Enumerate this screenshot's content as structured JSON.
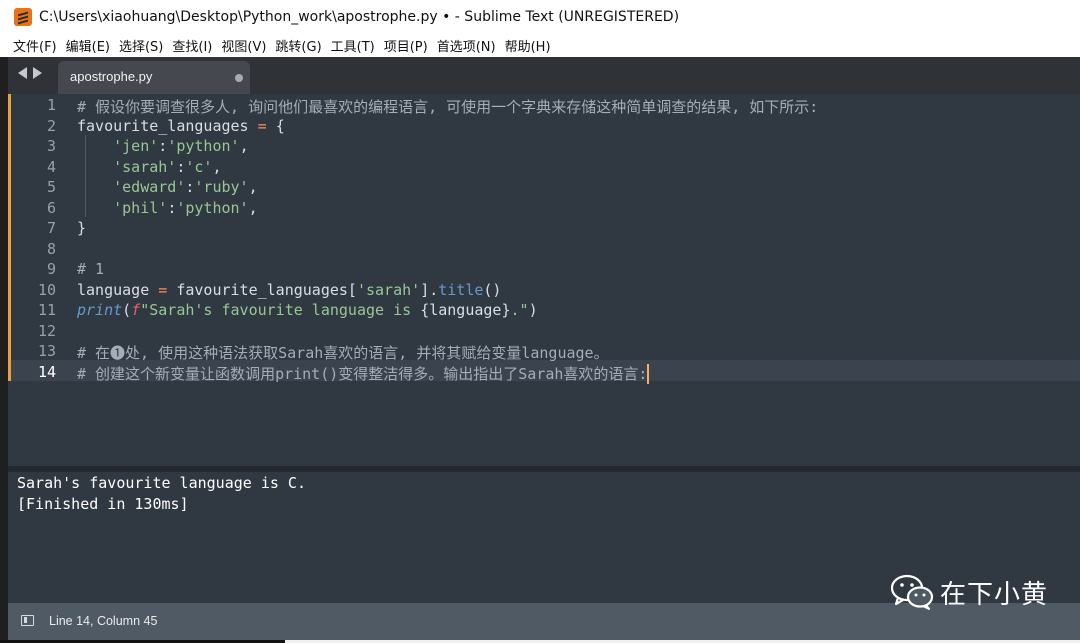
{
  "window": {
    "title": "C:\\Users\\xiaohuang\\Desktop\\Python_work\\apostrophe.py • - Sublime Text (UNREGISTERED)"
  },
  "menu": {
    "items": [
      "文件(F)",
      "编辑(E)",
      "选择(S)",
      "查找(I)",
      "视图(V)",
      "跳转(G)",
      "工具(T)",
      "项目(P)",
      "首选项(N)",
      "帮助(H)"
    ]
  },
  "tabs": [
    {
      "label": "apostrophe.py",
      "modified": true
    }
  ],
  "editor": {
    "current_line": 14,
    "line_numbers": [
      "1",
      "2",
      "3",
      "4",
      "5",
      "6",
      "7",
      "8",
      "9",
      "10",
      "11",
      "12",
      "13",
      "14"
    ],
    "code": {
      "l1": "# 假设你要调查很多人, 询问他们最喜欢的编程语言, 可使用一个字典来存储这种简单调查的结果, 如下所示:",
      "l2_name": "favourite_languages",
      "l2_op": "=",
      "l2_brace": "{",
      "l3_key": "'jen'",
      "l3_val": "'python'",
      "l4_key": "'sarah'",
      "l4_val": "'c'",
      "l5_key": "'edward'",
      "l5_val": "'ruby'",
      "l6_key": "'phil'",
      "l6_val": "'python'",
      "l7": "}",
      "l9": "# 1",
      "l10_var": "language",
      "l10_op": "=",
      "l10_obj": "favourite_languages[",
      "l10_key": "'sarah'",
      "l10_close": "].",
      "l10_method": "title",
      "l10_call": "()",
      "l11_fn": "print",
      "l11_f": "f",
      "l11_str1": "\"Sarah's favourite language is ",
      "l11_expr": "{language}",
      "l11_str2": ".\"",
      "l11_close": ")",
      "l13": "# 在❶处, 使用这种语法获取Sarah喜欢的语言, 并将其赋给变量language。",
      "l14": "# 创建这个新变量让函数调用print()变得整洁得多。输出指出了Sarah喜欢的语言:"
    }
  },
  "output": {
    "lines": [
      "Sarah's favourite language is C.",
      "[Finished in 130ms]"
    ]
  },
  "status": {
    "position": "Line 14, Column 45"
  },
  "watermark": {
    "text": "在下小黄"
  },
  "colors": {
    "editor_bg": "#303841",
    "comment": "#a6acb8",
    "string": "#99c794",
    "operator": "#f99157",
    "function": "#6699cc",
    "fstring_prefix": "#ec5f67",
    "gutter_marker": "#e9a23b"
  }
}
